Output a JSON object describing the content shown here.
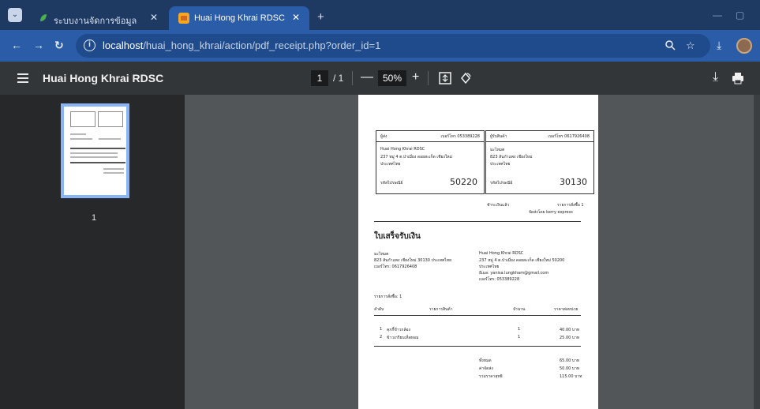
{
  "browser": {
    "tabs": [
      {
        "title": "ระบบงานจัดการข้อมูล",
        "active": false
      },
      {
        "title": "Huai Hong Khrai RDSC",
        "active": true
      }
    ],
    "url_host": "localhost",
    "url_path": "/huai_hong_khrai/action/pdf_receipt.php?order_id=1"
  },
  "pdf_toolbar": {
    "title": "Huai Hong Khrai RDSC",
    "current_page": "1",
    "total_pages": "/ 1",
    "zoom": "50%"
  },
  "sidebar": {
    "thumbnail_page": "1"
  },
  "receipt": {
    "sender": {
      "label": "ผู้ส่ง",
      "phone": "เบอร์โทร 053389228",
      "lines": [
        "Huai Hong Khrai RDSC",
        "237 หมู่ 4 ต.ป่าเมี่ยง ดอยสะเก็ด เชียงใหม่",
        "ประเทศไทย"
      ],
      "zip_label": "รหัสไปรษณีย์",
      "zip": "50220"
    },
    "recipient": {
      "label": "ผู้รับสินค้า",
      "phone": "เบอร์โทร 0617926408",
      "lines": [
        "มะไหมต",
        "823 สันกำแพง เชียงใหม่",
        "ประเทศไทย"
      ],
      "zip_label": "รหัสไปรษณีย์",
      "zip": "30130"
    },
    "payment": "ชำระเงินแล้ว",
    "order_label": "รายการสั่งซื้อ 1",
    "ship_via": "จัดส่งโดย kerry express",
    "title": "ใบเสร็จรับเงิน",
    "buyer": [
      "มะไหมต",
      "823 สันกำแพง เชียงใหม่ 30130 ประเทศไทย",
      "เบอร์โทร: 0617926408"
    ],
    "seller": [
      "Huai Hong Khrai RDSC",
      "237 หมู่ 4 ต.ป่าเมี่ยง ดอยสะเก็ด เชียงใหม่ 50200",
      "ประเทศไทย",
      "อีเมล: yanisa.lungkham@gmail.com",
      "เบอร์โทร: 053389228"
    ],
    "order_count": "รายการสั่งซื้อ: 1",
    "columns": [
      "ลำดับ",
      "รายการสินค้า",
      "จำนวน",
      "ราคาต่อหน่วย"
    ],
    "items": [
      {
        "no": "1",
        "name": "คุกกี้ข้าวกล้อง",
        "qty": "1",
        "price": "40.00 บาท"
      },
      {
        "no": "2",
        "name": "ข้าวเกรียบเห็ดหอม",
        "qty": "1",
        "price": "25.00 บาท"
      }
    ],
    "totals": [
      {
        "label": "ทั้งหมด",
        "value": "65.00 บาท"
      },
      {
        "label": "ค่าจัดส่ง",
        "value": "50.00 บาท"
      },
      {
        "label": "รวมราคาสุทธิ",
        "value": "115.00 บาท"
      }
    ]
  },
  "colors": {
    "tabbar": "#1e3a62",
    "toolbar": "#2b5ca8",
    "pdf_toolbar": "#323639",
    "viewer_bg": "#525659",
    "thumb_border": "#8ab4f8"
  }
}
